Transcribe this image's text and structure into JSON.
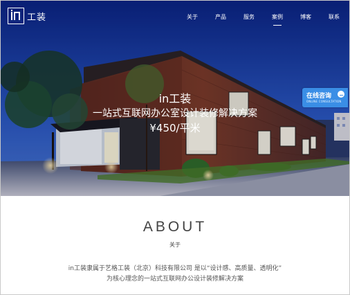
{
  "logo": {
    "text": "工装"
  },
  "nav": {
    "items": [
      {
        "label": "关于",
        "active": false
      },
      {
        "label": "产品",
        "active": false
      },
      {
        "label": "服务",
        "active": false
      },
      {
        "label": "案例",
        "active": true
      },
      {
        "label": "博客",
        "active": false
      },
      {
        "label": "联系",
        "active": false
      }
    ]
  },
  "hero": {
    "brand": "in工装",
    "slogan": "一站式互联网办公室设计装修解决方案",
    "price": "¥450/平米"
  },
  "chat_widget": {
    "label": "在线咨询",
    "sub": "ONLINE CONSULTATION",
    "icon": "chat-bubble-icon"
  },
  "about": {
    "title": "ABOUT",
    "subtitle": "关于",
    "desc_line1": "in工装隶属于艺格工装（北京）科技有限公司 是以“设计感、高质量、透明化”",
    "desc_line2": "为核心理念的一站式互联网办公设计装修解决方案"
  },
  "colors": {
    "sky_top": "#0d2a86",
    "sky_bottom": "#3262c6",
    "brick": "#6b3022",
    "accent": "#3a8ee6"
  }
}
